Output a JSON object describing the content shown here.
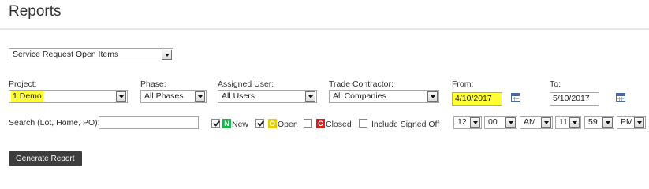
{
  "page": {
    "title": "Reports"
  },
  "report_type": {
    "value": "Service Request Open Items"
  },
  "filters": {
    "project": {
      "label": "Project:",
      "value": "1 Demo"
    },
    "phase": {
      "label": "Phase:",
      "value": "All Phases"
    },
    "assigned_user": {
      "label": "Assigned User:",
      "value": "All Users"
    },
    "trade_contractor": {
      "label": "Trade Contractor:",
      "value": "All Companies"
    },
    "from": {
      "label": "From:",
      "value": "4/10/2017"
    },
    "to": {
      "label": "To:",
      "value": "5/10/2017"
    },
    "search": {
      "label": "Search (Lot, Home, PO):",
      "value": ""
    }
  },
  "statuses": {
    "new": {
      "badge": "N",
      "label": "New",
      "checked": true,
      "color": "#22b14c"
    },
    "open": {
      "badge": "O",
      "label": "Open",
      "checked": true,
      "color": "#e3d000"
    },
    "closed": {
      "badge": "C",
      "label": "Closed",
      "checked": false,
      "color": "#d42020"
    },
    "signed_off": {
      "label": "Include Signed Off",
      "checked": false
    }
  },
  "time": {
    "start_hour": "12",
    "start_minute": "00",
    "start_ampm": "AM",
    "end_hour": "11",
    "end_minute": "59",
    "end_ampm": "PM"
  },
  "actions": {
    "generate": "Generate Report"
  }
}
